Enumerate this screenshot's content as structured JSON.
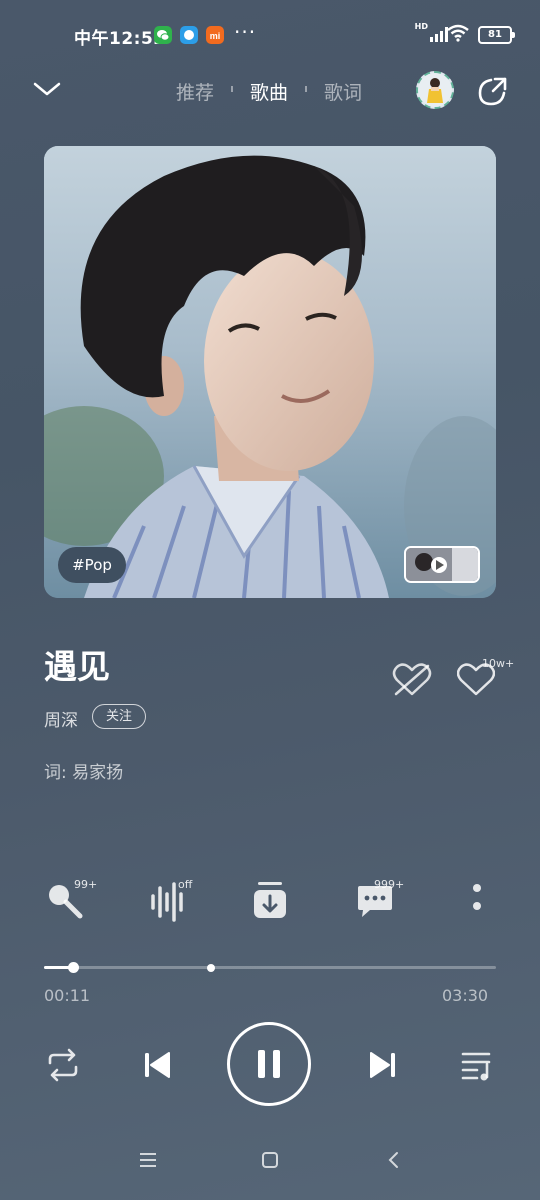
{
  "status": {
    "time": "中午12:52",
    "dots": "···",
    "hd": "HD",
    "battery": "81"
  },
  "nav": {
    "tabs": [
      {
        "label": "推荐"
      },
      {
        "label": "歌曲"
      },
      {
        "label": "歌词"
      }
    ]
  },
  "art": {
    "tag": "#Pop"
  },
  "song": {
    "title": "遇见",
    "artist": "周深",
    "follow": "关注",
    "lyricist": "词: 易家扬",
    "like_count": "10w+"
  },
  "actions": [
    {
      "icon": "karaoke-mic-icon",
      "badge": "99+"
    },
    {
      "icon": "sound-effect-icon",
      "badge": "off"
    },
    {
      "icon": "download-icon",
      "badge": ""
    },
    {
      "icon": "comment-icon",
      "badge": "999+"
    },
    {
      "icon": "more-icon",
      "badge": ""
    }
  ],
  "progress": {
    "current": "00:11",
    "total": "03:30",
    "fraction": 0.065,
    "marker_fraction": 0.37
  },
  "colors": {
    "background": "#4a586a",
    "accent": "#ffffff"
  }
}
